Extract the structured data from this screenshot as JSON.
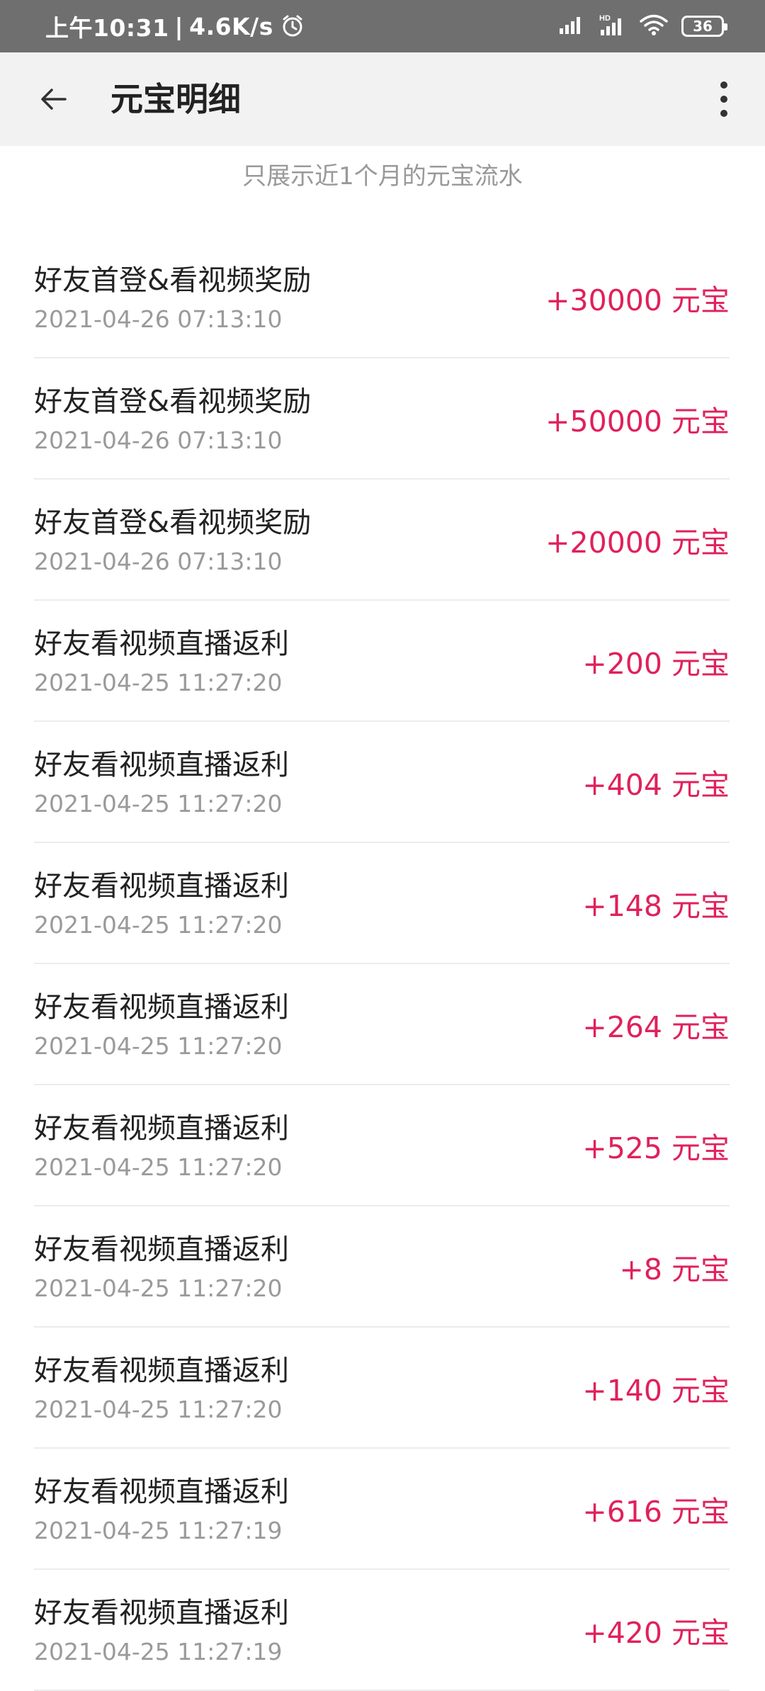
{
  "status_bar": {
    "time": "上午10:31",
    "separator": "|",
    "net_speed": "4.6K/s",
    "alarm_icon": "alarm-clock-icon",
    "hd_label": "HD",
    "battery": "36"
  },
  "header": {
    "back_icon": "arrow-left-icon",
    "title": "元宝明细",
    "more_icon": "more-vertical-icon"
  },
  "notice": "只展示近1个月的元宝流水",
  "colors": {
    "amount": "#e0215b",
    "app_bar_bg": "#f2f2f2",
    "status_bar_bg": "#6f6f6f"
  },
  "transactions": [
    {
      "title": "好友首登&看视频奖励",
      "time": "2021-04-26 07:13:10",
      "amount": "+30000 元宝"
    },
    {
      "title": "好友首登&看视频奖励",
      "time": "2021-04-26 07:13:10",
      "amount": "+50000 元宝"
    },
    {
      "title": "好友首登&看视频奖励",
      "time": "2021-04-26 07:13:10",
      "amount": "+20000 元宝"
    },
    {
      "title": "好友看视频直播返利",
      "time": "2021-04-25 11:27:20",
      "amount": "+200 元宝"
    },
    {
      "title": "好友看视频直播返利",
      "time": "2021-04-25 11:27:20",
      "amount": "+404 元宝"
    },
    {
      "title": "好友看视频直播返利",
      "time": "2021-04-25 11:27:20",
      "amount": "+148 元宝"
    },
    {
      "title": "好友看视频直播返利",
      "time": "2021-04-25 11:27:20",
      "amount": "+264 元宝"
    },
    {
      "title": "好友看视频直播返利",
      "time": "2021-04-25 11:27:20",
      "amount": "+525 元宝"
    },
    {
      "title": "好友看视频直播返利",
      "time": "2021-04-25 11:27:20",
      "amount": "+8 元宝"
    },
    {
      "title": "好友看视频直播返利",
      "time": "2021-04-25 11:27:20",
      "amount": "+140 元宝"
    },
    {
      "title": "好友看视频直播返利",
      "time": "2021-04-25 11:27:19",
      "amount": "+616 元宝"
    },
    {
      "title": "好友看视频直播返利",
      "time": "2021-04-25 11:27:19",
      "amount": "+420 元宝"
    }
  ]
}
